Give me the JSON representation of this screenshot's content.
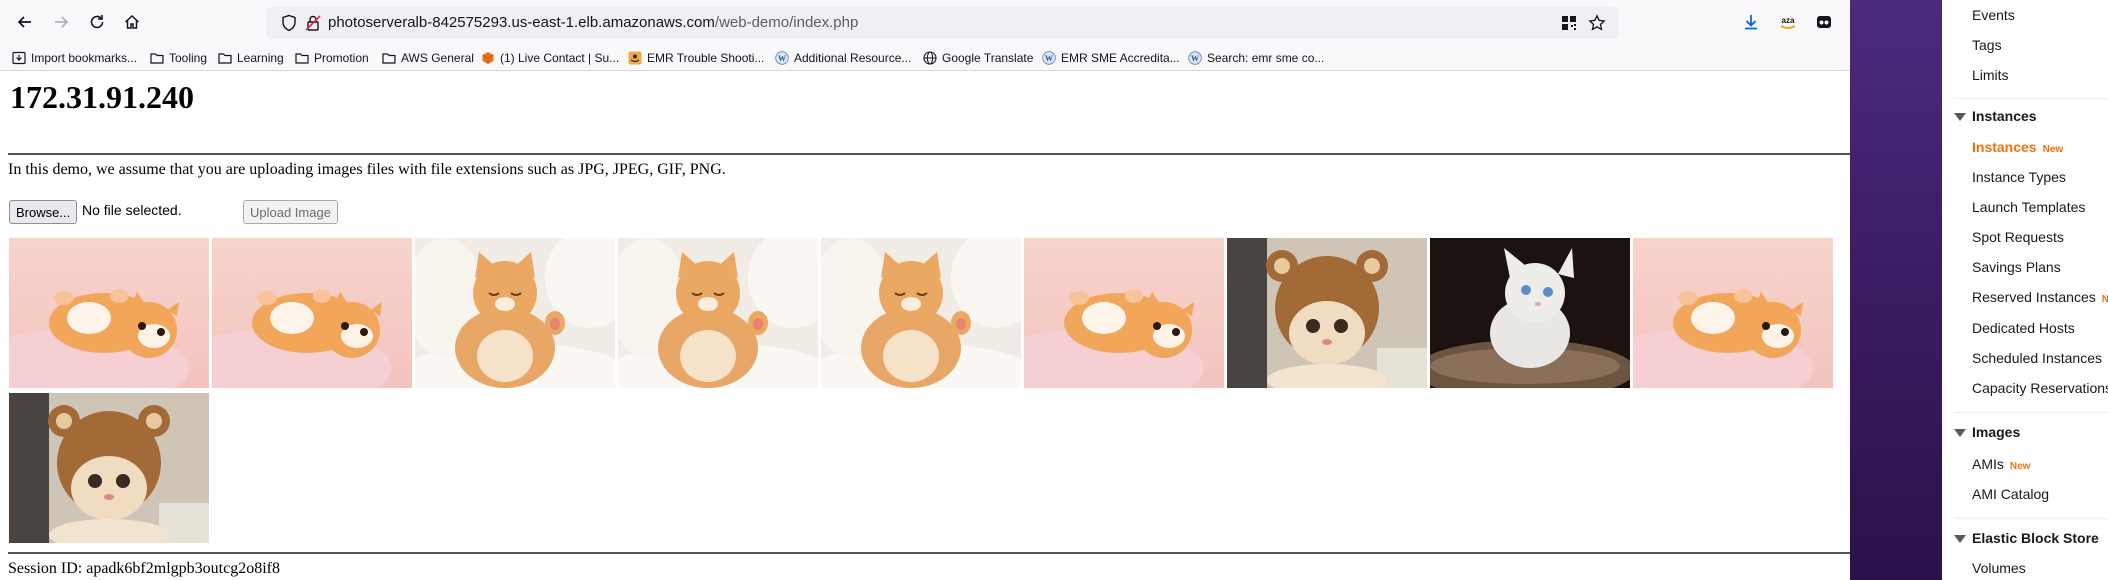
{
  "browser": {
    "url_host": "photoserveralb-842575293.us-east-1.elb.amazonaws.com",
    "url_path": "/web-demo/index.php",
    "bookmarks": [
      {
        "label": "Import bookmarks...",
        "icon": "import-icon"
      },
      {
        "label": "Tooling",
        "icon": "folder-icon"
      },
      {
        "label": "Learning",
        "icon": "folder-icon"
      },
      {
        "label": "Promotion",
        "icon": "folder-icon"
      },
      {
        "label": "AWS General",
        "icon": "folder-icon"
      },
      {
        "label": "(1) Live Contact | Su...",
        "icon": "aws-cube-icon"
      },
      {
        "label": "EMR Trouble Shooti...",
        "icon": "amazon-site-icon"
      },
      {
        "label": "Additional Resource...",
        "icon": "wiki-icon"
      },
      {
        "label": "Google Translate",
        "icon": "globe-icon"
      },
      {
        "label": "EMR SME Accredita...",
        "icon": "wiki-icon"
      },
      {
        "label": "Search: emr sme co...",
        "icon": "wiki-icon"
      }
    ]
  },
  "page": {
    "ip": "172.31.91.240",
    "intro": "In this demo, we assume that you are uploading images files with file extensions such as JPG, JPEG, GIF, PNG.",
    "browse_label": "Browse...",
    "no_file": "No file selected.",
    "upload_label": "Upload Image",
    "session": "Session ID: apadk6bf2mlgpb3outcg2o8if8",
    "images": [
      {
        "kind": "pink-kitten"
      },
      {
        "kind": "pink-kitten"
      },
      {
        "kind": "fluffy-kitten"
      },
      {
        "kind": "fluffy-kitten"
      },
      {
        "kind": "fluffy-kitten"
      },
      {
        "kind": "pink-kitten"
      },
      {
        "kind": "bear-hat-kitten"
      },
      {
        "kind": "white-kitten"
      },
      {
        "kind": "pink-kitten"
      },
      {
        "kind": "bear-hat-kitten"
      }
    ]
  },
  "sidebar": {
    "items_top": [
      "Events",
      "Tags",
      "Limits"
    ],
    "instances_header": "Instances",
    "instances_items": [
      {
        "label": "Instances",
        "badge": "New",
        "active": true
      },
      {
        "label": "Instance Types"
      },
      {
        "label": "Launch Templates"
      },
      {
        "label": "Spot Requests"
      },
      {
        "label": "Savings Plans"
      },
      {
        "label": "Reserved Instances",
        "badge": "N"
      },
      {
        "label": "Dedicated Hosts"
      },
      {
        "label": "Scheduled Instances"
      },
      {
        "label": "Capacity Reservations"
      }
    ],
    "images_header": "Images",
    "images_items": [
      {
        "label": "AMIs",
        "badge": "New"
      },
      {
        "label": "AMI Catalog"
      }
    ],
    "ebs_header": "Elastic Block Store",
    "ebs_items": [
      {
        "label": "Volumes"
      }
    ]
  },
  "colors": {
    "accent": "#ec7211",
    "purple": "#4b2a7d"
  }
}
